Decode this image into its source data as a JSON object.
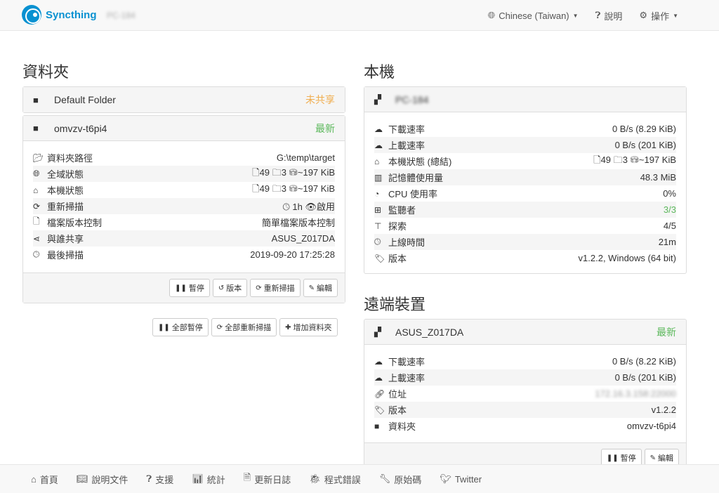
{
  "navbar": {
    "brand": "Syncthing",
    "device_name": "PC-184",
    "language": "Chinese (Taiwan)",
    "help": "說明",
    "actions": "操作"
  },
  "folders": {
    "heading": "資料夾",
    "default_folder": {
      "name": "Default Folder",
      "status": "未共享"
    },
    "omv": {
      "name": "omvzv-t6pi4",
      "status": "最新",
      "rows": [
        {
          "label": "資料夾路徑",
          "value": "G:\\temp\\target"
        },
        {
          "label": "全域狀態",
          "files": "49",
          "dirs": "3",
          "size": "~197 KiB"
        },
        {
          "label": "本機狀態",
          "files": "49",
          "dirs": "3",
          "size": "~197 KiB"
        },
        {
          "label": "重新掃描",
          "interval": "1h",
          "watch": "啟用"
        },
        {
          "label": "檔案版本控制",
          "value": "簡單檔案版本控制"
        },
        {
          "label": "與誰共享",
          "value": "ASUS_Z017DA"
        },
        {
          "label": "最後掃描",
          "value": "2019-09-20 17:25:28"
        }
      ],
      "buttons": {
        "pause": "暫停",
        "versions": "版本",
        "rescan": "重新掃描",
        "edit": "編輯"
      }
    },
    "global_buttons": {
      "pause_all": "全部暫停",
      "rescan_all": "全部重新掃描",
      "add_folder": "增加資料夾"
    }
  },
  "this_device": {
    "heading": "本機",
    "name": "PC-184",
    "rows": [
      {
        "label": "下載速率",
        "value": "0 B/s (8.29 KiB)"
      },
      {
        "label": "上載速率",
        "value": "0 B/s (201 KiB)"
      },
      {
        "label": "本機狀態 (總結)",
        "files": "49",
        "dirs": "3",
        "size": "~197 KiB"
      },
      {
        "label": "記憶體使用量",
        "value": "48.3 MiB"
      },
      {
        "label": "CPU 使用率",
        "value": "0%"
      },
      {
        "label": "監聽者",
        "value": "3/3"
      },
      {
        "label": "探索",
        "value": "4/5"
      },
      {
        "label": "上線時間",
        "value": "21m"
      },
      {
        "label": "版本",
        "value": "v1.2.2, Windows (64 bit)"
      }
    ]
  },
  "remote_devices": {
    "heading": "遠端裝置",
    "device": {
      "name": "ASUS_Z017DA",
      "status": "最新",
      "rows": [
        {
          "label": "下載速率",
          "value": "0 B/s (8.22 KiB)"
        },
        {
          "label": "上載速率",
          "value": "0 B/s (201 KiB)"
        },
        {
          "label": "位址",
          "value": "172.16.3.158:22000"
        },
        {
          "label": "版本",
          "value": "v1.2.2"
        },
        {
          "label": "資料夾",
          "value": "omvzv-t6pi4"
        }
      ],
      "buttons": {
        "pause": "暫停",
        "edit": "編輯"
      }
    }
  },
  "footer": {
    "home": "首頁",
    "docs": "說明文件",
    "support": "支援",
    "stats": "統計",
    "changelog": "更新日誌",
    "bugs": "程式錯誤",
    "source": "原始碼",
    "twitter": "Twitter"
  },
  "colors": {
    "brand": "#0891d1",
    "up_to_date": "#5cb85c",
    "unshared": "#f0ad4e"
  }
}
